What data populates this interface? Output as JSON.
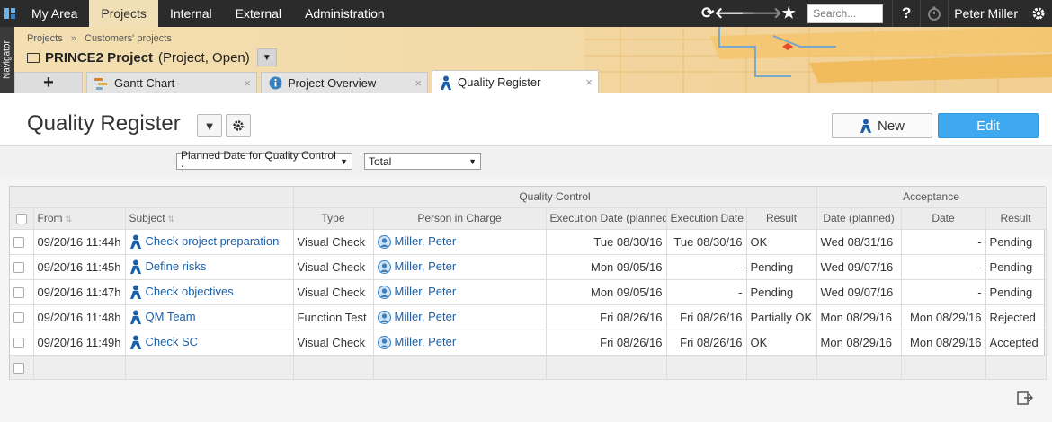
{
  "topbar": {
    "menu": [
      {
        "label": "My Area",
        "active": false
      },
      {
        "label": "Projects",
        "active": true
      },
      {
        "label": "Internal",
        "active": false
      },
      {
        "label": "External",
        "active": false
      },
      {
        "label": "Administration",
        "active": false
      }
    ],
    "search_placeholder": "Search...",
    "help_label": "?",
    "user_name": "Peter Miller"
  },
  "navigator_label": "Navigator",
  "breadcrumb": [
    "Projects",
    "Customers' projects"
  ],
  "breadcrumb_sep": "»",
  "project": {
    "name": "PRINCE2 Project",
    "details": "(Project, Open)"
  },
  "tabs": {
    "add": "+",
    "items": [
      {
        "label": "Gantt Chart",
        "icon": "gantt-icon",
        "active": false
      },
      {
        "label": "Project Overview",
        "icon": "info-icon",
        "active": false
      },
      {
        "label": "Quality Register",
        "icon": "person-icon",
        "active": true
      }
    ],
    "close": "×"
  },
  "page": {
    "title": "Quality Register",
    "new_label": "New",
    "edit_label": "Edit"
  },
  "filters": {
    "date_field": "Planned Date for Quality Control :",
    "range": "Total"
  },
  "table": {
    "groups": {
      "quality_control": "Quality Control",
      "acceptance": "Acceptance"
    },
    "headers": {
      "from": "From",
      "subject": "Subject",
      "type": "Type",
      "person": "Person in Charge",
      "exec_planned": "Execution Date (planned)",
      "exec_date": "Execution Date",
      "result": "Result",
      "acc_planned": "Date (planned)",
      "acc_date": "Date",
      "acc_result": "Result"
    },
    "rows": [
      {
        "from": "09/20/16 11:44h",
        "subject": "Check project preparation",
        "type": "Visual Check",
        "person": "Miller, Peter",
        "exec_planned": "Tue 08/30/16",
        "exec_date": "Tue 08/30/16",
        "result": "OK",
        "acc_planned": "Wed 08/31/16",
        "acc_date": "-",
        "acc_result": "Pending"
      },
      {
        "from": "09/20/16 11:45h",
        "subject": "Define risks",
        "type": "Visual Check",
        "person": "Miller, Peter",
        "exec_planned": "Mon 09/05/16",
        "exec_date": "-",
        "result": "Pending",
        "acc_planned": "Wed 09/07/16",
        "acc_date": "-",
        "acc_result": "Pending"
      },
      {
        "from": "09/20/16 11:47h",
        "subject": "Check objectives",
        "type": "Visual Check",
        "person": "Miller, Peter",
        "exec_planned": "Mon 09/05/16",
        "exec_date": "-",
        "result": "Pending",
        "acc_planned": "Wed 09/07/16",
        "acc_date": "-",
        "acc_result": "Pending"
      },
      {
        "from": "09/20/16 11:48h",
        "subject": "QM Team",
        "type": "Function Test",
        "person": "Miller, Peter",
        "exec_planned": "Fri 08/26/16",
        "exec_date": "Fri 08/26/16",
        "result": "Partially OK",
        "acc_planned": "Mon 08/29/16",
        "acc_date": "Mon 08/29/16",
        "acc_result": "Rejected"
      },
      {
        "from": "09/20/16 11:49h",
        "subject": "Check SC",
        "type": "Visual Check",
        "person": "Miller, Peter",
        "exec_planned": "Fri 08/26/16",
        "exec_date": "Fri 08/26/16",
        "result": "OK",
        "acc_planned": "Mon 08/29/16",
        "acc_date": "Mon 08/29/16",
        "acc_result": "Accepted"
      }
    ]
  },
  "colors": {
    "accent": "#3fa9ef",
    "link": "#1b5fa8",
    "topbar": "#2b2b2b",
    "banner": "#f3dfb3"
  }
}
